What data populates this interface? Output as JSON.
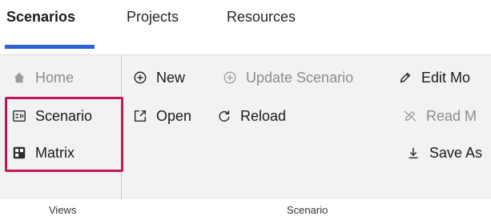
{
  "tabs": [
    {
      "label": "Scenarios",
      "active": true
    },
    {
      "label": "Projects",
      "active": false
    },
    {
      "label": "Resources",
      "active": false
    }
  ],
  "groups": {
    "views": {
      "label": "Views",
      "items": [
        {
          "label": "Home",
          "icon": "home-icon",
          "enabled": false
        },
        {
          "label": "Scenario",
          "icon": "scenario-view-icon",
          "enabled": true
        },
        {
          "label": "Matrix",
          "icon": "matrix-icon",
          "enabled": true
        }
      ]
    },
    "scenario": {
      "label": "Scenario",
      "items": [
        {
          "label": "New",
          "icon": "add-circle-icon",
          "enabled": true
        },
        {
          "label": "Update Scenario",
          "icon": "update-circle-icon",
          "enabled": false
        },
        {
          "label": "Edit Mo",
          "icon": "pencil-icon",
          "enabled": true
        },
        {
          "label": "Open",
          "icon": "open-external-icon",
          "enabled": true
        },
        {
          "label": "Reload",
          "icon": "reload-icon",
          "enabled": true
        },
        {
          "label": "Read M",
          "icon": "pencil-off-icon",
          "enabled": false
        },
        {
          "label": "Save As",
          "icon": "download-icon",
          "enabled": true
        }
      ]
    }
  },
  "colors": {
    "accent": "#2b62d8",
    "highlight": "#c2185b",
    "ribbon_bg": "#f2f2f2",
    "disabled_text": "#8c8c8c"
  }
}
